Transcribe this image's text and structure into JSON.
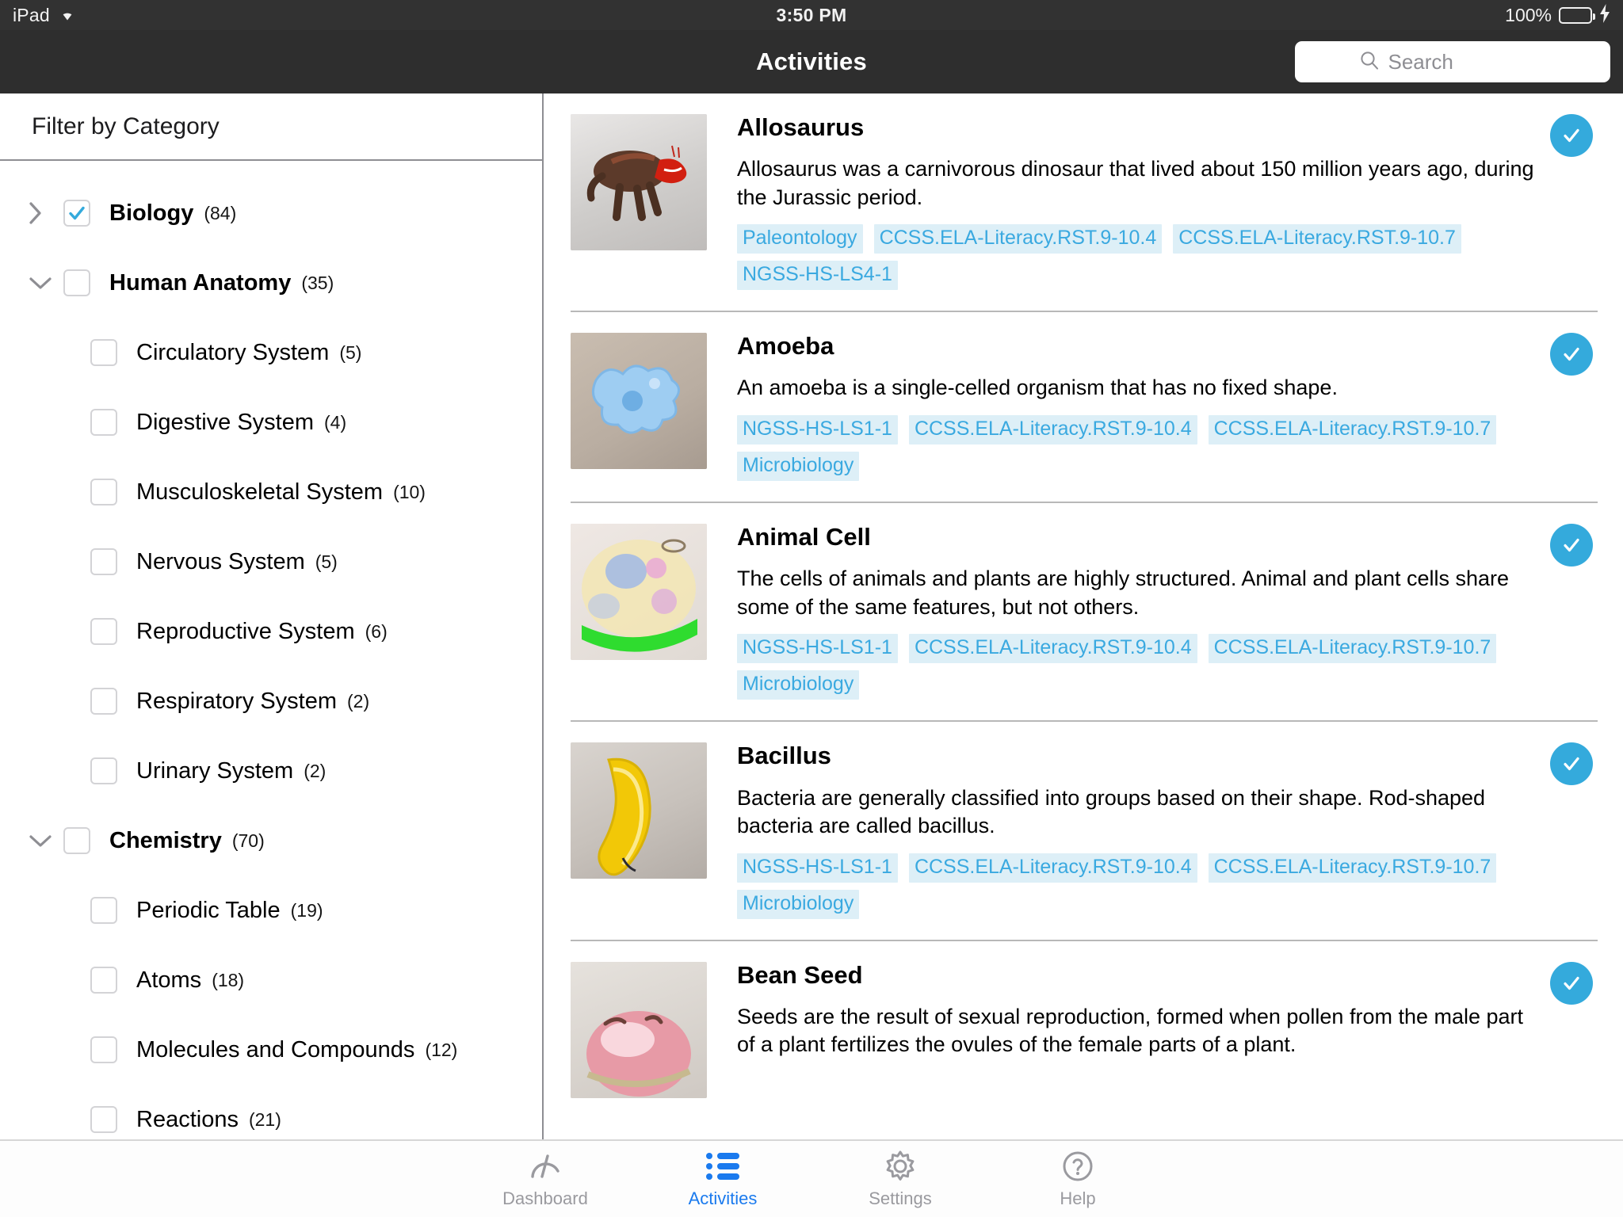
{
  "statusbar": {
    "device": "iPad",
    "wifi_icon": "wifi-icon",
    "time": "3:50 PM",
    "battery_percent": "100%",
    "battery_icon": "battery-icon",
    "charging_icon": "lightning-bolt-icon"
  },
  "navbar": {
    "title": "Activities",
    "search_icon": "search-icon",
    "search_placeholder": "Search",
    "search_value": ""
  },
  "sidebar": {
    "header": "Filter by Category",
    "filters": [
      {
        "label": "Biology",
        "count": "(84)",
        "level": 0,
        "checked": true,
        "disclosure": "chevron-right-icon"
      },
      {
        "label": "Human Anatomy",
        "count": "(35)",
        "level": 0,
        "checked": false,
        "disclosure": "chevron-down-icon"
      },
      {
        "label": "Circulatory System",
        "count": "(5)",
        "level": 1,
        "checked": false,
        "disclosure": ""
      },
      {
        "label": "Digestive System",
        "count": "(4)",
        "level": 1,
        "checked": false,
        "disclosure": ""
      },
      {
        "label": "Musculoskeletal System",
        "count": "(10)",
        "level": 1,
        "checked": false,
        "disclosure": ""
      },
      {
        "label": "Nervous System",
        "count": "(5)",
        "level": 1,
        "checked": false,
        "disclosure": ""
      },
      {
        "label": "Reproductive System",
        "count": "(6)",
        "level": 1,
        "checked": false,
        "disclosure": ""
      },
      {
        "label": "Respiratory System",
        "count": "(2)",
        "level": 1,
        "checked": false,
        "disclosure": ""
      },
      {
        "label": "Urinary System",
        "count": "(2)",
        "level": 1,
        "checked": false,
        "disclosure": ""
      },
      {
        "label": "Chemistry",
        "count": "(70)",
        "level": 0,
        "checked": false,
        "disclosure": "chevron-down-icon"
      },
      {
        "label": "Periodic Table",
        "count": "(19)",
        "level": 1,
        "checked": false,
        "disclosure": ""
      },
      {
        "label": "Atoms",
        "count": "(18)",
        "level": 1,
        "checked": false,
        "disclosure": ""
      },
      {
        "label": "Molecules and Compounds",
        "count": "(12)",
        "level": 1,
        "checked": false,
        "disclosure": ""
      },
      {
        "label": "Reactions",
        "count": "(21)",
        "level": 1,
        "checked": false,
        "disclosure": ""
      }
    ]
  },
  "activities": [
    {
      "title": "Allosaurus",
      "description": "Allosaurus was a carnivorous dinosaur that lived about 150 million years ago, during the Jurassic period.",
      "tags": [
        "Paleontology",
        "CCSS.ELA-Literacy.RST.9-10.4",
        "CCSS.ELA-Literacy.RST.9-10.7",
        "NGSS-HS-LS4-1"
      ],
      "selected": true,
      "thumbnail": "allosaurus-thumbnail"
    },
    {
      "title": "Amoeba",
      "description": "An amoeba is a single-celled organism that has no fixed shape.",
      "tags": [
        "NGSS-HS-LS1-1",
        "CCSS.ELA-Literacy.RST.9-10.4",
        "CCSS.ELA-Literacy.RST.9-10.7",
        "Microbiology"
      ],
      "selected": true,
      "thumbnail": "amoeba-thumbnail"
    },
    {
      "title": "Animal Cell",
      "description": "The cells of animals and plants are highly structured. Animal and plant cells share some of the same features, but not others.",
      "tags": [
        "NGSS-HS-LS1-1",
        "CCSS.ELA-Literacy.RST.9-10.4",
        "CCSS.ELA-Literacy.RST.9-10.7",
        "Microbiology"
      ],
      "selected": true,
      "thumbnail": "animal-cell-thumbnail"
    },
    {
      "title": "Bacillus",
      "description": "Bacteria are generally classified into groups based on their shape. Rod-shaped bacteria are called bacillus.",
      "tags": [
        "NGSS-HS-LS1-1",
        "CCSS.ELA-Literacy.RST.9-10.4",
        "CCSS.ELA-Literacy.RST.9-10.7",
        "Microbiology"
      ],
      "selected": true,
      "thumbnail": "bacillus-thumbnail"
    },
    {
      "title": "Bean Seed",
      "description": "Seeds are the result of sexual reproduction, formed when pollen from the male part of a plant fertilizes the ovules of the female parts of a plant.",
      "tags": [],
      "selected": true,
      "thumbnail": "bean-seed-thumbnail"
    }
  ],
  "tabbar": {
    "tabs": [
      {
        "label": "Dashboard",
        "icon": "gauge-icon",
        "active": false
      },
      {
        "label": "Activities",
        "icon": "list-icon",
        "active": true
      },
      {
        "label": "Settings",
        "icon": "gear-icon",
        "active": false
      },
      {
        "label": "Help",
        "icon": "question-circle-icon",
        "active": false
      }
    ]
  },
  "colors": {
    "accent_blue": "#1a7aee",
    "badge_blue": "#34aadc",
    "tag_bg": "#ddeff7",
    "tag_text": "#3aa9e0",
    "statusbar_bg": "#323232",
    "navbar_bg": "#2e2e2e",
    "battery_green": "#4cd964"
  }
}
